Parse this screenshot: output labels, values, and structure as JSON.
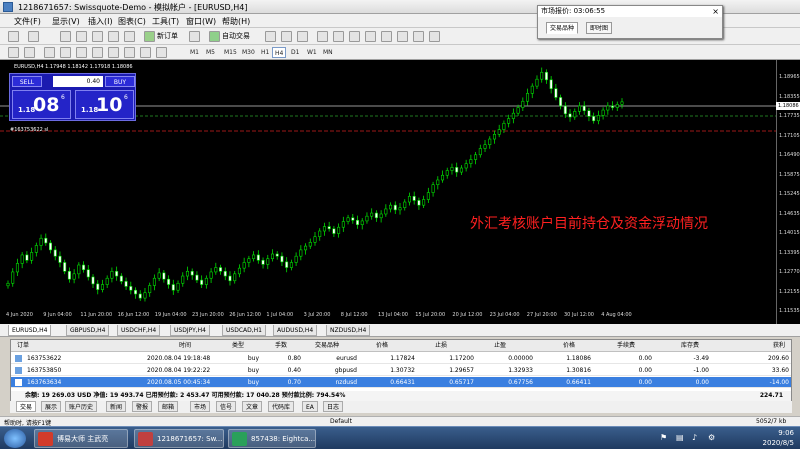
{
  "window": {
    "title": "1218671657: Swissquote-Demo - 模拟帐户 - [EURUSD,H4]"
  },
  "menu": [
    "文件(F)",
    "显示(V)",
    "插入(I)",
    "图表(C)",
    "工具(T)",
    "窗口(W)",
    "帮助(H)"
  ],
  "toolbar": {
    "new_order": "新订单",
    "auto_trade": "自动交易"
  },
  "timeframes": [
    "M1",
    "M5",
    "M15",
    "M30",
    "H1",
    "H4",
    "D1",
    "W1",
    "MN"
  ],
  "active_timeframe": "H4",
  "market_watch": {
    "title": "市场报价: 03:06:55",
    "close": "×",
    "tabs": [
      "交易品种",
      "即时图"
    ]
  },
  "chart_info": "EURUSD,H4  1.17948 1.18142 1.17918 1.18086",
  "trade_panel": {
    "sell": "SELL",
    "buy": "BUY",
    "lot": "0.40",
    "sell_prefix": "1.18",
    "sell_big": "08",
    "sell_sup": "6",
    "buy_prefix": "1.18",
    "buy_big": "10",
    "buy_sup": "6"
  },
  "order_label": "#163753622 sl",
  "overlay_text": "外汇考核账户目前持仓及资金浮动情况",
  "current_price": "1.18086",
  "chart_data": {
    "type": "candlestick",
    "price_ticks": [
      "1.18965",
      "1.18355",
      "1.17735",
      "1.17105",
      "1.16490",
      "1.15875",
      "1.15245",
      "1.14635",
      "1.14015",
      "1.13395",
      "1.12770",
      "1.12155",
      "1.11535"
    ],
    "time_ticks": [
      "4 Jun 2020",
      "9 Jun 04:00",
      "11 Jun 20:00",
      "16 Jun 12:00",
      "19 Jun 04:00",
      "23 Jun 20:00",
      "26 Jun 12:00",
      "1 Jul 04:00",
      "3 Jul 20:00",
      "8 Jul 12:00",
      "13 Jul 04:00",
      "15 Jul 20:00",
      "20 Jul 12:00",
      "23 Jul 04:00",
      "27 Jul 20:00",
      "30 Jul 12:00",
      "4 Aug 04:00"
    ],
    "closes": [
      1.1232,
      1.1268,
      1.1295,
      1.1322,
      1.1305,
      1.133,
      1.1352,
      1.1375,
      1.136,
      1.1338,
      1.1318,
      1.1298,
      1.127,
      1.1245,
      1.1262,
      1.129,
      1.1275,
      1.1252,
      1.123,
      1.1212,
      1.1228,
      1.1248,
      1.127,
      1.1255,
      1.1238,
      1.1222,
      1.121,
      1.1198,
      1.1185,
      1.1202,
      1.1225,
      1.1248,
      1.1265,
      1.1245,
      1.1228,
      1.121,
      1.1232,
      1.1255,
      1.127,
      1.1258,
      1.1242,
      1.1228,
      1.1248,
      1.1268,
      1.1282,
      1.127,
      1.1255,
      1.124,
      1.1262,
      1.128,
      1.1298,
      1.131,
      1.1322,
      1.1305,
      1.1292,
      1.131,
      1.1325,
      1.1318,
      1.13,
      1.1282,
      1.1298,
      1.1318,
      1.1338,
      1.135,
      1.1362,
      1.138,
      1.1398,
      1.1412,
      1.1405,
      1.139,
      1.141,
      1.1428,
      1.144,
      1.1432,
      1.1418,
      1.143,
      1.1445,
      1.1455,
      1.144,
      1.1452,
      1.1468,
      1.148,
      1.1465,
      1.1472,
      1.149,
      1.1508,
      1.1495,
      1.148,
      1.1498,
      1.152,
      1.1545,
      1.156,
      1.1575,
      1.159,
      1.16,
      1.1585,
      1.1598,
      1.1612,
      1.1625,
      1.164,
      1.166,
      1.1672,
      1.169,
      1.1705,
      1.172,
      1.174,
      1.1755,
      1.1772,
      1.179,
      1.181,
      1.1835,
      1.1858,
      1.188,
      1.1902,
      1.1878,
      1.185,
      1.1822,
      1.1795,
      1.177,
      1.176,
      1.1778,
      1.1795,
      1.178,
      1.1762,
      1.1748,
      1.1765,
      1.1782,
      1.1795,
      1.179,
      1.18,
      1.1808
    ]
  },
  "chart_tabs": [
    "EURUSD,H4",
    "GBPUSD,H4",
    "USDCHF,H4",
    "USDJPY,H4",
    "USDCAD,H1",
    "AUDUSD,H4",
    "NZDUSD,H4"
  ],
  "terminal": {
    "headers": [
      "订单",
      "时间",
      "类型",
      "手数",
      "交易品种",
      "价格",
      "止损",
      "止盈",
      "价格",
      "手续费",
      "库存费",
      "获利"
    ],
    "rows": [
      [
        "163753622",
        "2020.08.04 19:18:48",
        "buy",
        "0.80",
        "eurusd",
        "1.17824",
        "1.17200",
        "0.00000",
        "1.18086",
        "0.00",
        "-3.49",
        "209.60"
      ],
      [
        "163753850",
        "2020.08.04 19:22:22",
        "buy",
        "0.40",
        "gbpusd",
        "1.30732",
        "1.29657",
        "1.32933",
        "1.30816",
        "0.00",
        "-1.00",
        "33.60"
      ],
      [
        "163763634",
        "2020.08.05 00:45:34",
        "buy",
        "0.70",
        "nzdusd",
        "0.66431",
        "0.65717",
        "0.67756",
        "0.66411",
        "0.00",
        "0.00",
        "-14.00"
      ]
    ],
    "summary": "余额: 19 269.03 USD  净值: 19 493.74  已用预付款: 2 453.47  可用预付款: 17 040.28  预付款比例: 794.54%",
    "summary_total": "224.71"
  },
  "bottom_tabs": [
    "交易",
    "展示",
    "账户历史",
    "新闻",
    "警报",
    "邮箱",
    "市场",
    "信号",
    "文章",
    "代码库",
    "EA",
    "日志"
  ],
  "status": {
    "left": "帮助时, 请按F1键",
    "profile": "Default",
    "traffic": "5052/7 kb"
  },
  "taskbar": {
    "items": [
      "博易大师 主武亮",
      "1218671657: Sw...",
      "857438: Eightca..."
    ],
    "time": "9:06",
    "date": "2020/8/5"
  }
}
